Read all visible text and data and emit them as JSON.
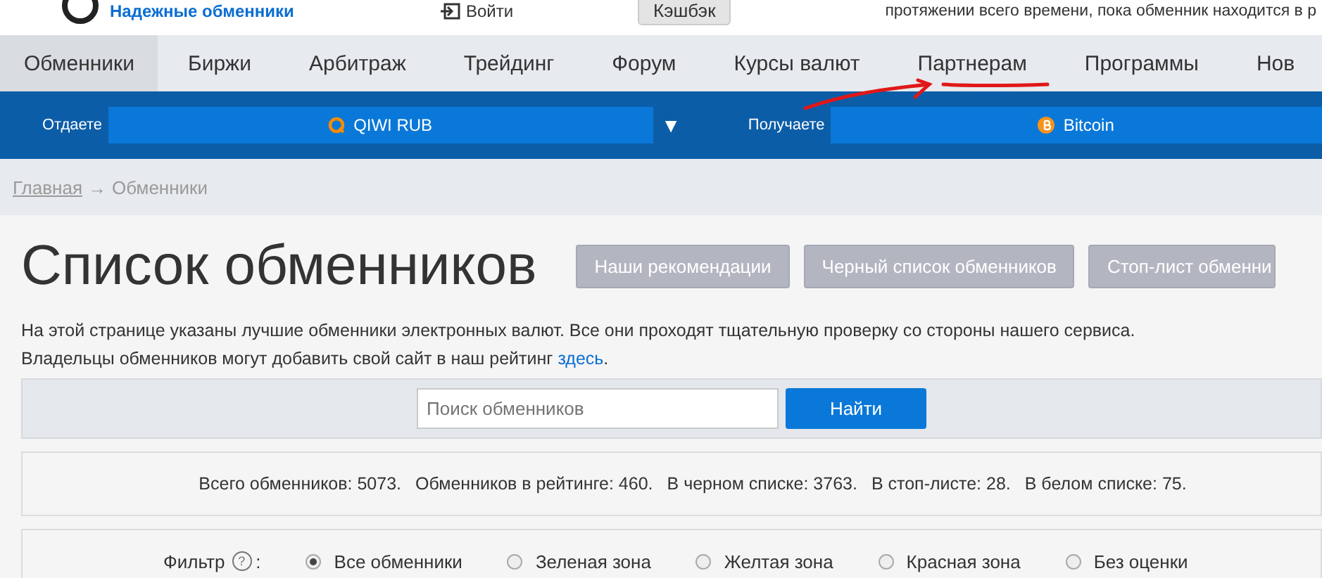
{
  "top_bar": {
    "tagline": "Надежные обменники",
    "login": "Войти",
    "cashback_button": "Кэшбэк",
    "notice": "протяжении всего времени, пока обменник находится в р"
  },
  "nav": [
    {
      "label": "Обменники",
      "selected": true
    },
    {
      "label": "Биржи",
      "selected": false
    },
    {
      "label": "Арбитраж",
      "selected": false
    },
    {
      "label": "Трейдинг",
      "selected": false
    },
    {
      "label": "Форум",
      "selected": false
    },
    {
      "label": "Курсы валют",
      "selected": false
    },
    {
      "label": "Партнерам",
      "selected": false
    },
    {
      "label": "Программы",
      "selected": false
    },
    {
      "label": "Нов",
      "selected": false
    }
  ],
  "exchange": {
    "give_label": "Отдаете",
    "give_value": "QIWI RUB",
    "dropdown_arrow": "▼",
    "get_label": "Получаете",
    "get_value": "Bitcoin"
  },
  "breadcrumb": {
    "home": "Главная",
    "separator": "→",
    "current": "Обменники"
  },
  "page": {
    "title": "Список обменников",
    "buttons": [
      "Наши рекомендации",
      "Черный список обменников",
      "Стоп-лист обменни"
    ],
    "intro": "На этой странице указаны лучшие обменники электронных валют. Все они проходят тщательную проверку со стороны нашего сервиса.",
    "intro2": "Владельцы обменников могут добавить свой сайт в наш рейтинг",
    "intro_link": "здесь",
    "intro_end": "."
  },
  "search": {
    "placeholder": "Поиск обменников",
    "button": "Найти"
  },
  "stats": [
    "Всего обменников: 5073.",
    "Обменников в рейтинге: 460.",
    "В черном списке: 3763.",
    "В стоп-листе: 28.",
    "В белом списке: 75."
  ],
  "filter": {
    "label": "Фильтр",
    "help": "?",
    "colon": ":",
    "options": [
      {
        "label": "Все обменники",
        "selected": true
      },
      {
        "label": "Зеленая зона",
        "selected": false
      },
      {
        "label": "Желтая зона",
        "selected": false
      },
      {
        "label": "Красная зона",
        "selected": false
      },
      {
        "label": "Без оценки",
        "selected": false
      }
    ]
  }
}
